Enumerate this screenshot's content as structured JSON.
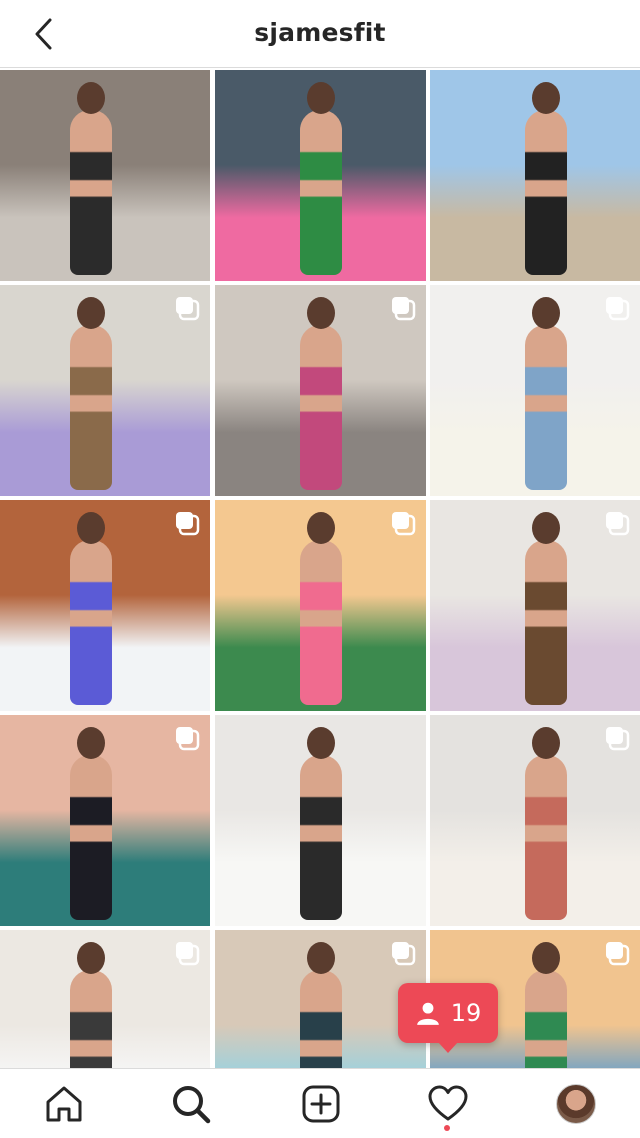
{
  "header": {
    "title": "sjamesfit",
    "back_icon": "chevron-left-icon"
  },
  "grid": {
    "tiles": [
      {
        "id": "post-1",
        "multi": false,
        "scene": "gym-locker",
        "colors": [
          "#8a8078",
          "#c9c3bc",
          "#2b2b2b"
        ]
      },
      {
        "id": "post-2",
        "multi": false,
        "scene": "gym-squat",
        "colors": [
          "#4a5a68",
          "#ef6aa1",
          "#2e8c44"
        ]
      },
      {
        "id": "post-3",
        "multi": false,
        "scene": "beach-dunes",
        "colors": [
          "#9fc6e8",
          "#c8b9a2",
          "#222222"
        ]
      },
      {
        "id": "post-4",
        "multi": true,
        "scene": "room-lavender",
        "colors": [
          "#d9d6cf",
          "#a99bd6",
          "#8a6a4a"
        ]
      },
      {
        "id": "post-5",
        "multi": true,
        "scene": "stairs-leopard",
        "colors": [
          "#cfc8c0",
          "#8a8480",
          "#c2497c"
        ]
      },
      {
        "id": "post-6",
        "multi": true,
        "scene": "white-wall-jeans",
        "colors": [
          "#f1f0ee",
          "#f5f3ea",
          "#7fa4c8"
        ]
      },
      {
        "id": "post-7",
        "multi": true,
        "scene": "hot-tub-snow",
        "colors": [
          "#b3643c",
          "#f2f4f6",
          "#5b5bd6"
        ]
      },
      {
        "id": "post-8",
        "multi": true,
        "scene": "gym-turf",
        "colors": [
          "#f4c890",
          "#3c8a4e",
          "#f06b8f"
        ]
      },
      {
        "id": "post-9",
        "multi": true,
        "scene": "room-pink-lamp",
        "colors": [
          "#e9e6e2",
          "#d8c6da",
          "#6a4a30"
        ]
      },
      {
        "id": "post-10",
        "multi": true,
        "scene": "pink-wall-floor",
        "colors": [
          "#e6b6a2",
          "#2d7d7a",
          "#1c1c24"
        ]
      },
      {
        "id": "post-11",
        "multi": false,
        "scene": "living-room-sofa",
        "colors": [
          "#e9e7e4",
          "#f7f7f5",
          "#2a2a2a"
        ]
      },
      {
        "id": "post-12",
        "multi": true,
        "scene": "window-curtains",
        "colors": [
          "#e4e2df",
          "#f3efe9",
          "#c56a5c"
        ]
      },
      {
        "id": "post-13",
        "multi": true,
        "scene": "bedroom-white-dress",
        "colors": [
          "#ece8e2",
          "#f7f7f7",
          "#3a3a3a"
        ]
      },
      {
        "id": "post-14",
        "multi": true,
        "scene": "hallway-leggings",
        "colors": [
          "#d8c9b8",
          "#9ad2e0",
          "#28404a"
        ]
      },
      {
        "id": "post-15",
        "multi": true,
        "scene": "beach-sunset-dog",
        "colors": [
          "#f1c48f",
          "#6aa0c9",
          "#2f8a52"
        ]
      }
    ]
  },
  "likes_badge": {
    "icon": "person-icon",
    "count": "19"
  },
  "tabbar": {
    "home_icon": "home-icon",
    "search_icon": "search-icon",
    "add_icon": "add-post-icon",
    "activity_icon": "heart-icon",
    "profile_icon": "profile-avatar"
  }
}
